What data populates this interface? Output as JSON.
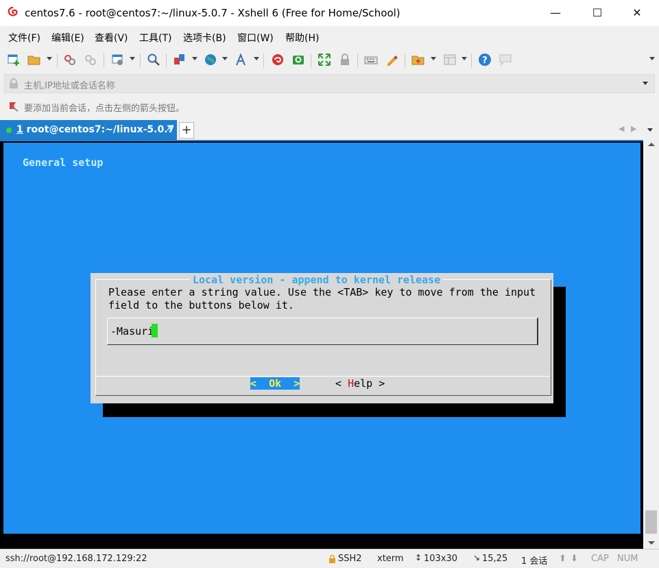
{
  "window": {
    "title": "centos7.6 - root@centos7:~/linux-5.0.7 - Xshell 6 (Free for Home/School)",
    "minimize": "—",
    "maximize": "☐",
    "close": "✕"
  },
  "menu": {
    "items": [
      "文件(F)",
      "编辑(E)",
      "查看(V)",
      "工具(T)",
      "选项卡(B)",
      "窗口(W)",
      "帮助(H)"
    ]
  },
  "toolbar": {
    "icons": [
      "new-session-icon",
      "open-folder-icon",
      "reconnect-icon",
      "disconnect-icon",
      "properties-icon",
      "find-icon",
      "transfer-icon",
      "globe-icon",
      "font-icon",
      "xshell-icon",
      "xftp-icon",
      "fullscreen-icon",
      "lock-icon",
      "keyboard-icon",
      "highlight-icon",
      "compose-icon",
      "layout-icon",
      "help-icon",
      "chat-icon"
    ]
  },
  "address": {
    "placeholder": "主机,IP地址或会话名称"
  },
  "hint": {
    "text": "要添加当前会话，点击左侧的箭头按钮。"
  },
  "tabs": [
    {
      "number": "1",
      "label": "root@centos7:~/linux-5.0.7",
      "active": true
    }
  ],
  "tab_add": "+",
  "tab_close": "✕",
  "terminal": {
    "heading": "General setup",
    "dialog": {
      "title": "Local version - append to kernel release",
      "line1": "Please enter a string value. Use the <TAB> key to move from the input",
      "line2": "field to the buttons below it.",
      "input_value": "-Masuri",
      "ok": "<  Ok  >",
      "help_open": "< ",
      "help_hotkey": "H",
      "help_rest": "elp >"
    }
  },
  "status": {
    "connection": "ssh://root@192.168.172.129:22",
    "protocol": "SSH2",
    "terminal_type": "xterm",
    "size": "103x30",
    "cursor_pos": "15,25",
    "sessions": "1 会话",
    "cap": "CAP",
    "num": "NUM"
  },
  "colors": {
    "terminal_bg": "#1e8ff0",
    "tab_active": "#1f7fcf",
    "dialog_bg": "#d8d8d8",
    "cursor": "#22e022",
    "dialog_title": "#36a8e8"
  }
}
